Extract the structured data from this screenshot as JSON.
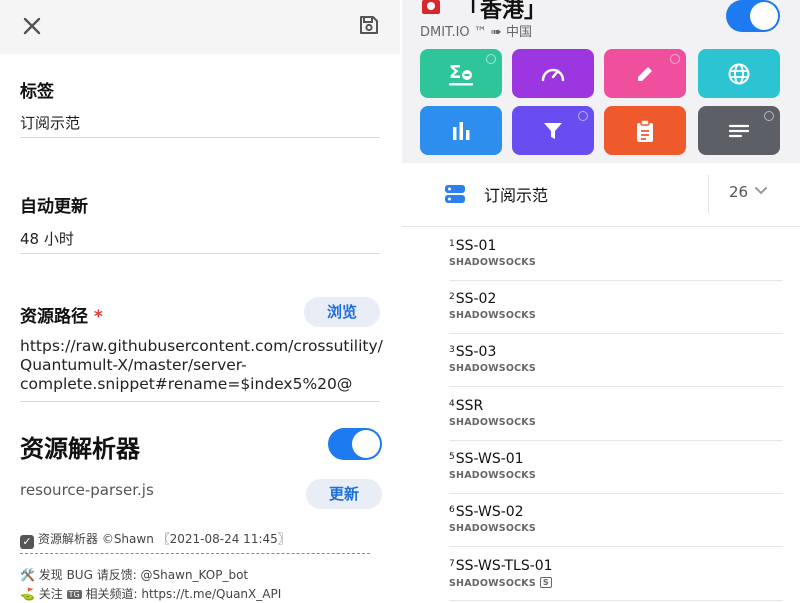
{
  "left": {
    "label_section": {
      "title": "标签",
      "value": "订阅示范"
    },
    "auto_update": {
      "title": "自动更新",
      "value": "48 小时"
    },
    "resource_path": {
      "title": "资源路径",
      "required_mark": "*",
      "browse_label": "浏览",
      "url_lines": [
        "https://raw.githubusercontent.com/crossutility/",
        "Quantumult-X/master/server-",
        "complete.snippet#rename=$index5%20@"
      ]
    },
    "parser": {
      "title": "资源解析器",
      "enabled": true,
      "file": "resource-parser.js",
      "update_label": "更新"
    },
    "notes": {
      "line1": "资源解析器 ©Shawn 〖2021-08-24 11:45〗",
      "line2": "🛠️ 发现 BUG 请反馈: @Shawn_KOP_bot",
      "line3_prefix": "⛳ 关注",
      "line3_badge": "TG",
      "line3_suffix": "相关频道: https://t.me/QuanX_API"
    }
  },
  "right": {
    "server": {
      "title": "「香港」",
      "subtitle": "DMIT.IO ™ ➠ 中国",
      "enabled": true
    },
    "tiles": [
      {
        "icon": "sigma-filter-icon",
        "color": "#2fc59b"
      },
      {
        "icon": "speedometer-icon",
        "color": "#9b36e0"
      },
      {
        "icon": "pencil-icon",
        "color": "#ef4f9c"
      },
      {
        "icon": "globe-icon",
        "color": "#2cc3d2"
      },
      {
        "icon": "bar-chart-icon",
        "color": "#2d8ef0"
      },
      {
        "icon": "funnel-icon",
        "color": "#6a4df0"
      },
      {
        "icon": "clipboard-icon",
        "color": "#ef5a2c"
      },
      {
        "icon": "lines-icon",
        "color": "#5d5f66"
      }
    ],
    "group": {
      "name": "订阅示范",
      "count": "26"
    },
    "servers": [
      {
        "index": "1",
        "name": "SS-01",
        "type": "SHADOWSOCKS",
        "badge": ""
      },
      {
        "index": "2",
        "name": "SS-02",
        "type": "SHADOWSOCKS",
        "badge": ""
      },
      {
        "index": "3",
        "name": "SS-03",
        "type": "SHADOWSOCKS",
        "badge": ""
      },
      {
        "index": "4",
        "name": "SSR",
        "type": "SHADOWSOCKS",
        "badge": ""
      },
      {
        "index": "5",
        "name": "SS-WS-01",
        "type": "SHADOWSOCKS",
        "badge": ""
      },
      {
        "index": "6",
        "name": "SS-WS-02",
        "type": "SHADOWSOCKS",
        "badge": ""
      },
      {
        "index": "7",
        "name": "SS-WS-TLS-01",
        "type": "SHADOWSOCKS",
        "badge": "S"
      }
    ]
  }
}
